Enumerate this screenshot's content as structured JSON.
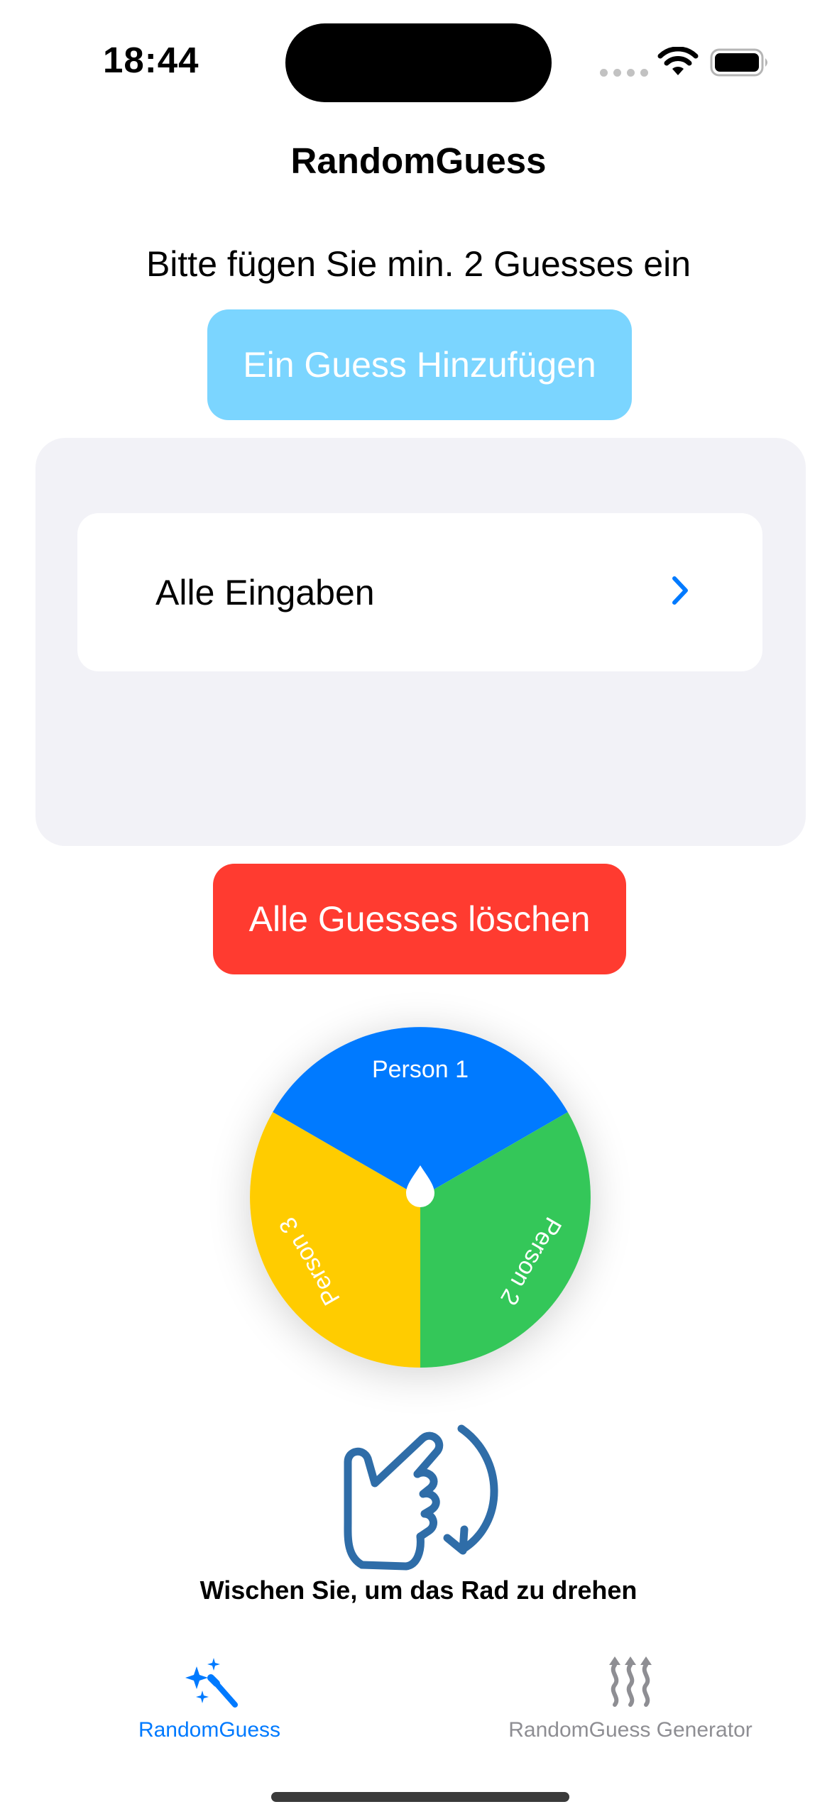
{
  "status_bar": {
    "time": "18:44"
  },
  "nav": {
    "title": "RandomGuess"
  },
  "prompt": "Bitte fügen Sie min. 2 Guesses ein",
  "add_button": {
    "label": "Ein Guess Hinzufügen"
  },
  "list": {
    "row_label": "Alle Eingaben"
  },
  "delete_button": {
    "label": "Alle Guesses löschen"
  },
  "wheel": {
    "segments": [
      {
        "label": "Person 1",
        "color": "#007aff"
      },
      {
        "label": "Person 2",
        "color": "#34c759"
      },
      {
        "label": "Person 3",
        "color": "#ffcc00"
      }
    ]
  },
  "hint": "Wischen Sie, um das Rad zu drehen",
  "tabs": [
    {
      "label": "RandomGuess",
      "icon": "sparkles-wand-icon",
      "active": true
    },
    {
      "label": "RandomGuess Generator",
      "icon": "heat-waves-icon",
      "active": false
    }
  ],
  "colors": {
    "accent": "#007aff",
    "tab_inactive": "#8e8e93",
    "delete": "#ff3b30",
    "add": "#7bd5ff"
  }
}
